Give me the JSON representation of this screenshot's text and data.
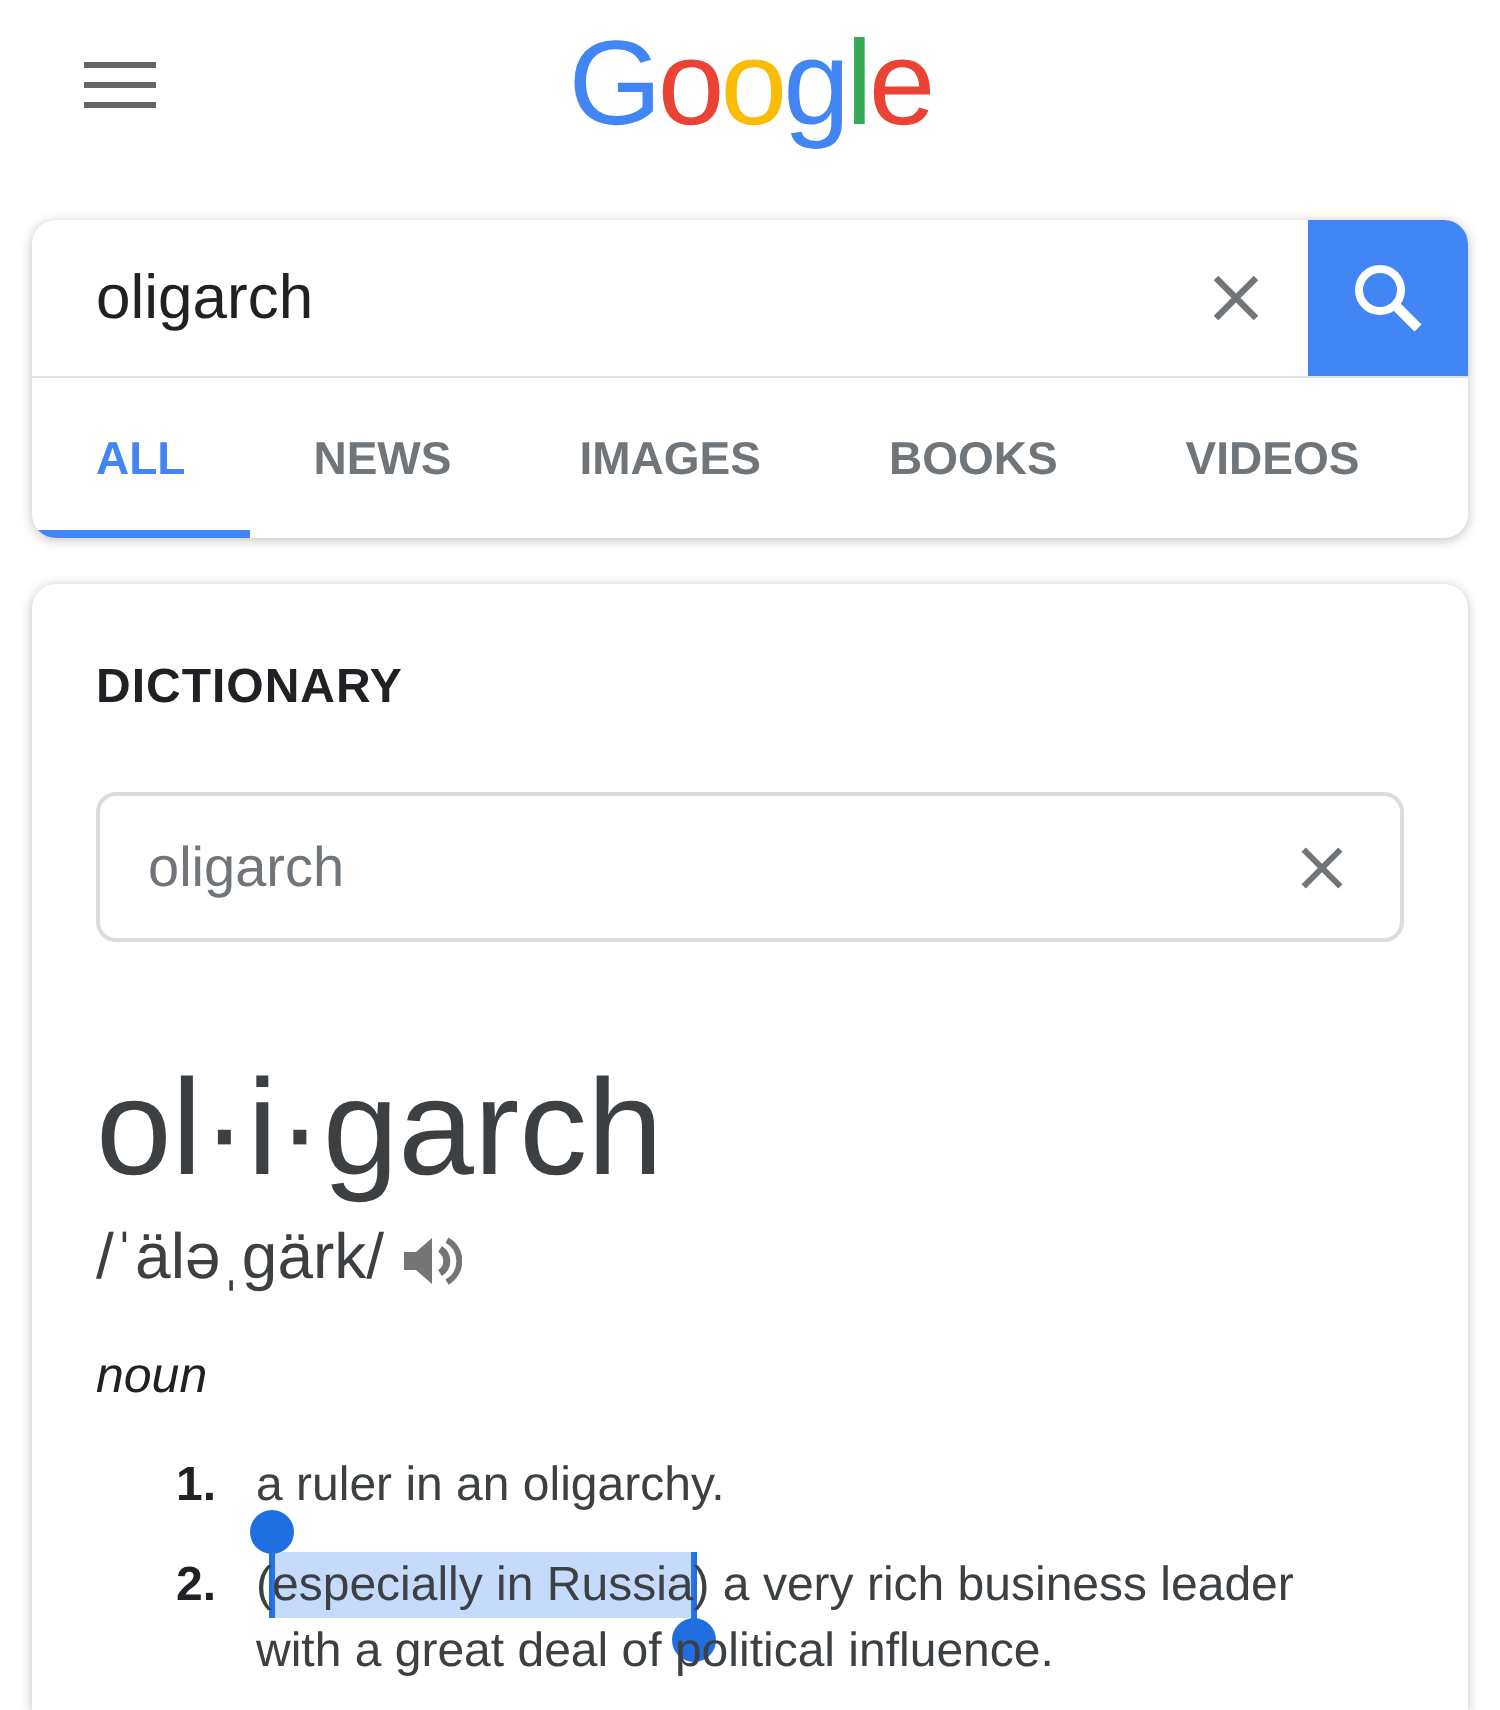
{
  "header": {
    "logo": "Google"
  },
  "search": {
    "query": "oligarch"
  },
  "tabs": [
    {
      "label": "ALL",
      "selected": true
    },
    {
      "label": "NEWS",
      "selected": false
    },
    {
      "label": "IMAGES",
      "selected": false
    },
    {
      "label": "BOOKS",
      "selected": false
    },
    {
      "label": "VIDEOS",
      "selected": false
    }
  ],
  "dictionary": {
    "title": "DICTIONARY",
    "search_value": "oligarch",
    "headword": "ol·i·garch",
    "pronunciation": "/ˈäləˌgärk/",
    "part_of_speech": "noun",
    "definitions": [
      {
        "number": "1.",
        "segments": [
          {
            "text": "a ruler in an oligarchy.",
            "selected": false
          }
        ]
      },
      {
        "number": "2.",
        "segments": [
          {
            "text": "(",
            "selected": false
          },
          {
            "text": "especially in Russia",
            "selected": true
          },
          {
            "text": ") a very rich business leader with a great deal of political influence.",
            "selected": false
          }
        ]
      }
    ]
  }
}
